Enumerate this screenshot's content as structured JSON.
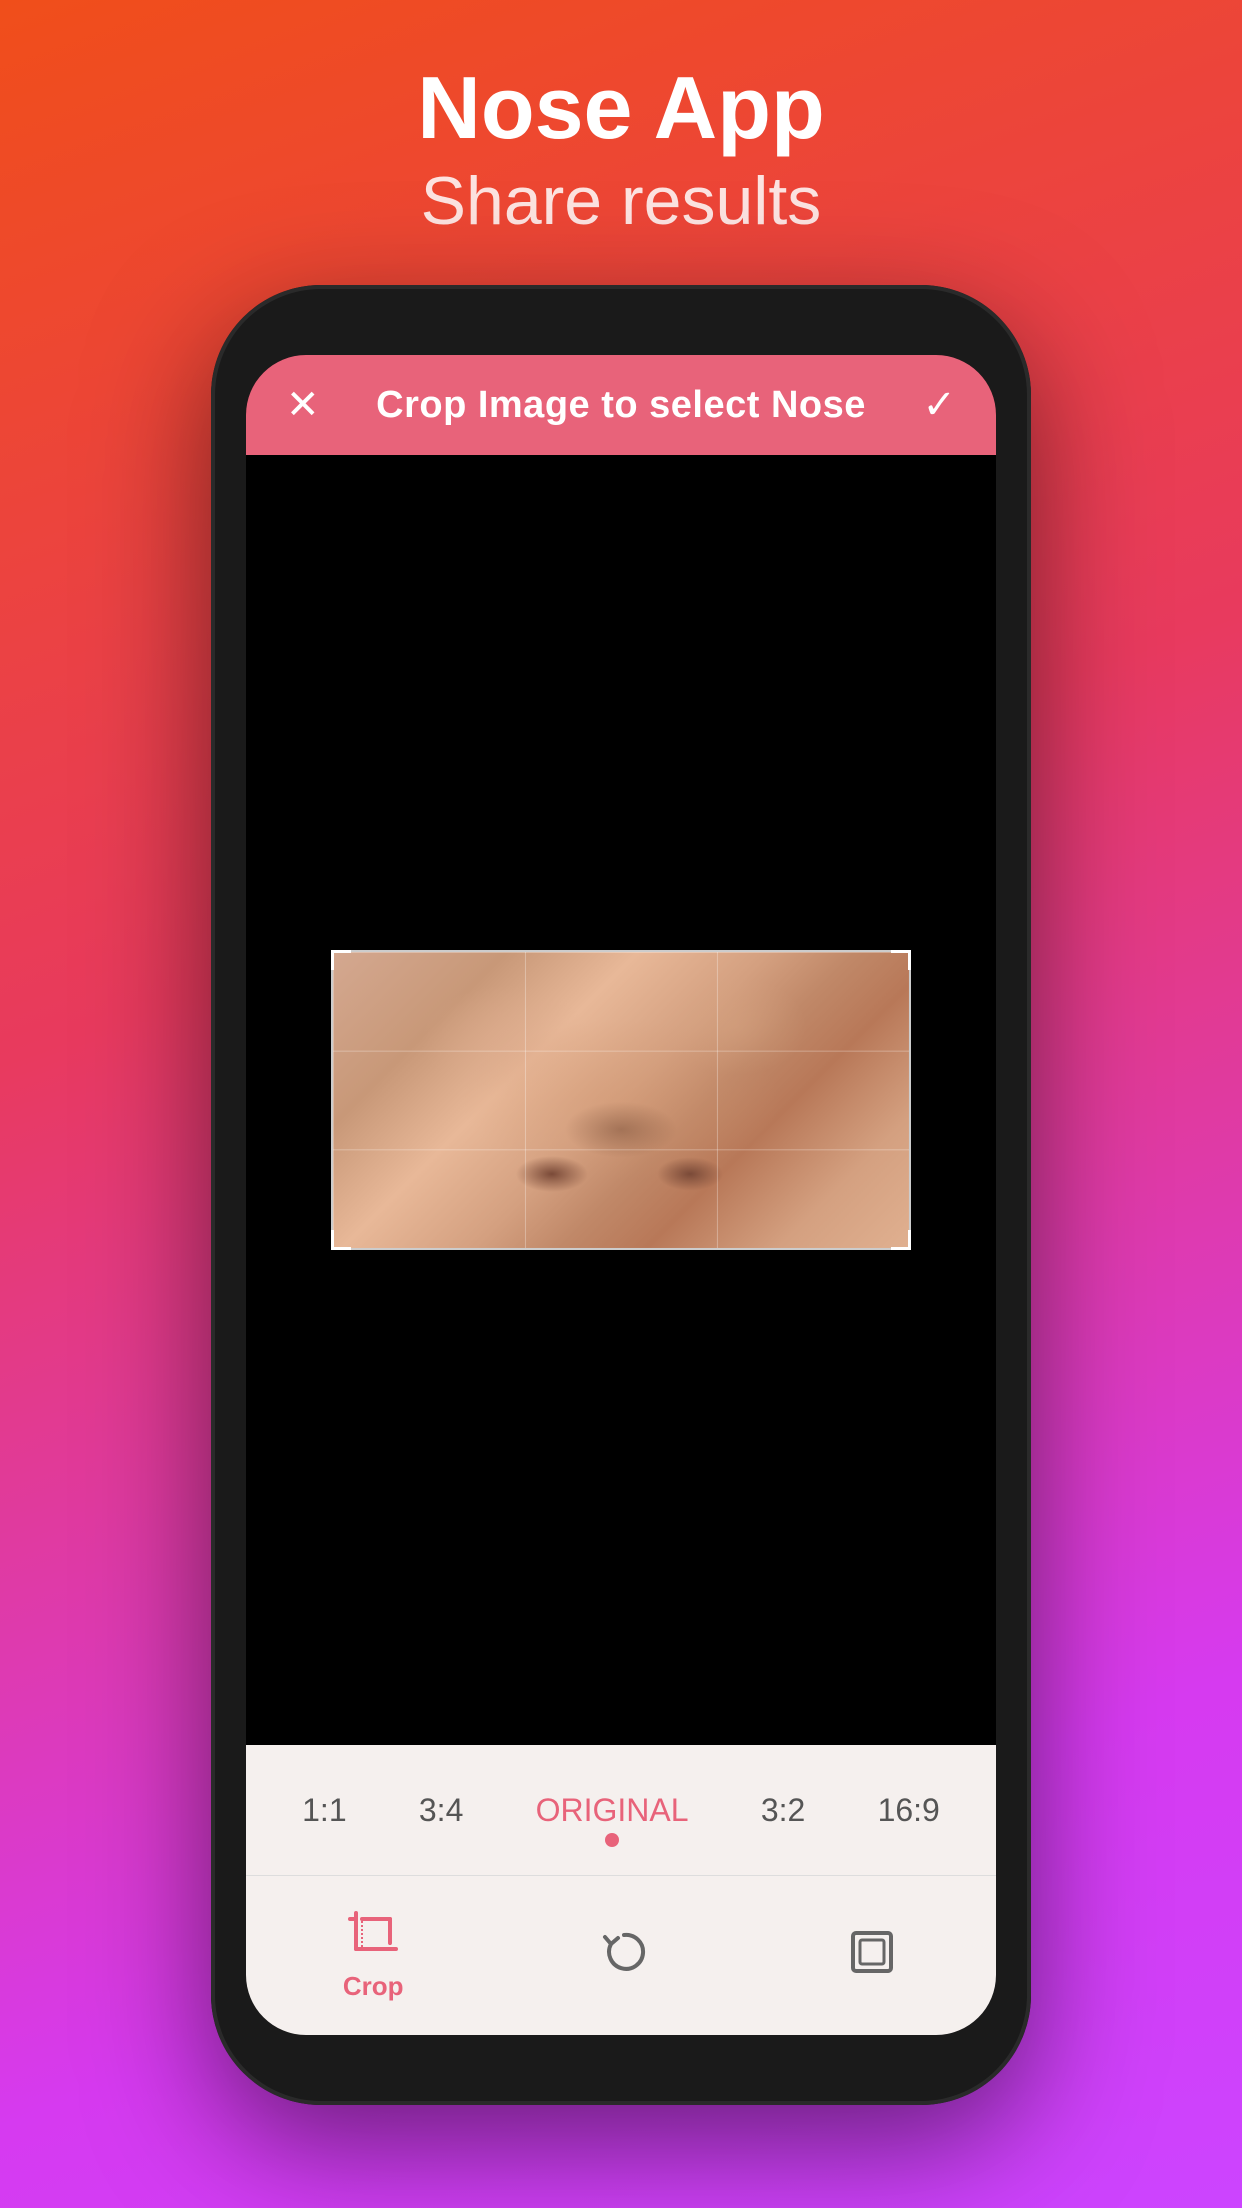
{
  "header": {
    "app_title": "Nose App",
    "app_subtitle": "Share results"
  },
  "crop_bar": {
    "title": "Crop Image to select Nose",
    "close_icon": "✕",
    "confirm_icon": "✓"
  },
  "aspect_ratios": [
    {
      "label": "1:1",
      "active": false
    },
    {
      "label": "3:4",
      "active": false
    },
    {
      "label": "ORIGINAL",
      "active": true
    },
    {
      "label": "3:2",
      "active": false
    },
    {
      "label": "16:9",
      "active": false
    }
  ],
  "toolbar": {
    "crop_label": "Crop",
    "crop_icon": "crop",
    "refresh_icon": "refresh",
    "expand_icon": "expand"
  },
  "colors": {
    "accent": "#e8637a",
    "background_gradient_start": "#f04e1a",
    "background_gradient_end": "#cc44ff",
    "phone_bg": "#1a1a1a",
    "screen_bg": "#000000"
  }
}
